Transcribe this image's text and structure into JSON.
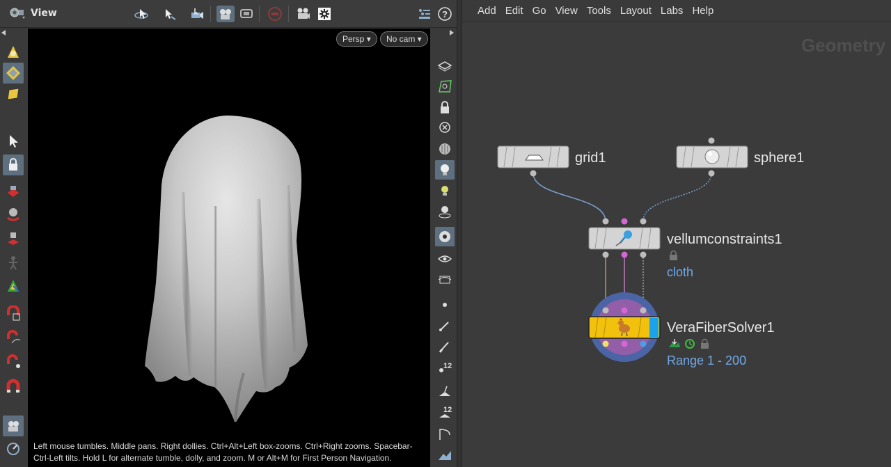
{
  "viewer": {
    "title": "View",
    "camera_view": "Persp",
    "camera": "No cam",
    "hint": "Left mouse tumbles. Middle pans. Right dollies. Ctrl+Alt+Left box-zooms. Ctrl+Right zooms. Spacebar-Ctrl-Left tilts. Hold L for alternate tumble, dolly, and zoom.     M or Alt+M for First Person Navigation.",
    "toolbar_icons": [
      "viewer-menu-icon",
      "tumble-icon",
      "select-arrow-icon",
      "camera-select-icon",
      "camera-view-icon",
      "screen-icon",
      "stop-icon",
      "render-flipbook-icon",
      "display-settings-icon",
      "layout-icon",
      "help-icon"
    ],
    "left_shelf_icons": [
      "soft-sphere-icon",
      "select-primitive-icon",
      "select-box-icon",
      "arrow-select-icon",
      "lock-select-icon",
      "move-tool-icon",
      "rotate-tool-icon",
      "scale-tool-icon",
      "pose-tool-icon",
      "handle-tool-icon",
      "magnet-snap-icon",
      "magnet-curve-icon",
      "magnet-point-icon",
      "magnet-icon",
      "camera-tool-icon",
      "dolly-icon"
    ],
    "right_shelf_icons": [
      "plane-icon",
      "geo-icon",
      "lock-icon",
      "ghost-icon",
      "sphere-shade-icon",
      "light-bulb-icon",
      "light-add-icon",
      "light-ghost-icon",
      "camera-link-icon",
      "eye-icon",
      "eye-hide-icon",
      "dot-icon",
      "pencil-icon",
      "brush-icon",
      "point-numbers-icon",
      "normal-icon",
      "prim-numbers-icon",
      "angle-icon",
      "mountain-icon"
    ],
    "numeric_badge": "12"
  },
  "network": {
    "menu": [
      "Add",
      "Edit",
      "Go",
      "View",
      "Tools",
      "Layout",
      "Labs",
      "Help"
    ],
    "context": "Geometry",
    "nodes": {
      "grid": {
        "name": "grid1"
      },
      "sphere": {
        "name": "sphere1"
      },
      "constraints": {
        "name": "vellumconstraints1",
        "sub": "cloth"
      },
      "solver": {
        "name": "VeraFiberSolver1",
        "sub": "Range 1 - 200"
      }
    }
  },
  "colors": {
    "accent": "#5e6f80",
    "wire": "#7ba2d0",
    "constraint_port": "#d666d6",
    "solver_body": "#f1c10d",
    "solver_flag": "#1aa3ea",
    "solver_halo_outer": "#4b64a6",
    "solver_halo_inner": "#a45ca8",
    "label_blue": "#70a8e8"
  }
}
